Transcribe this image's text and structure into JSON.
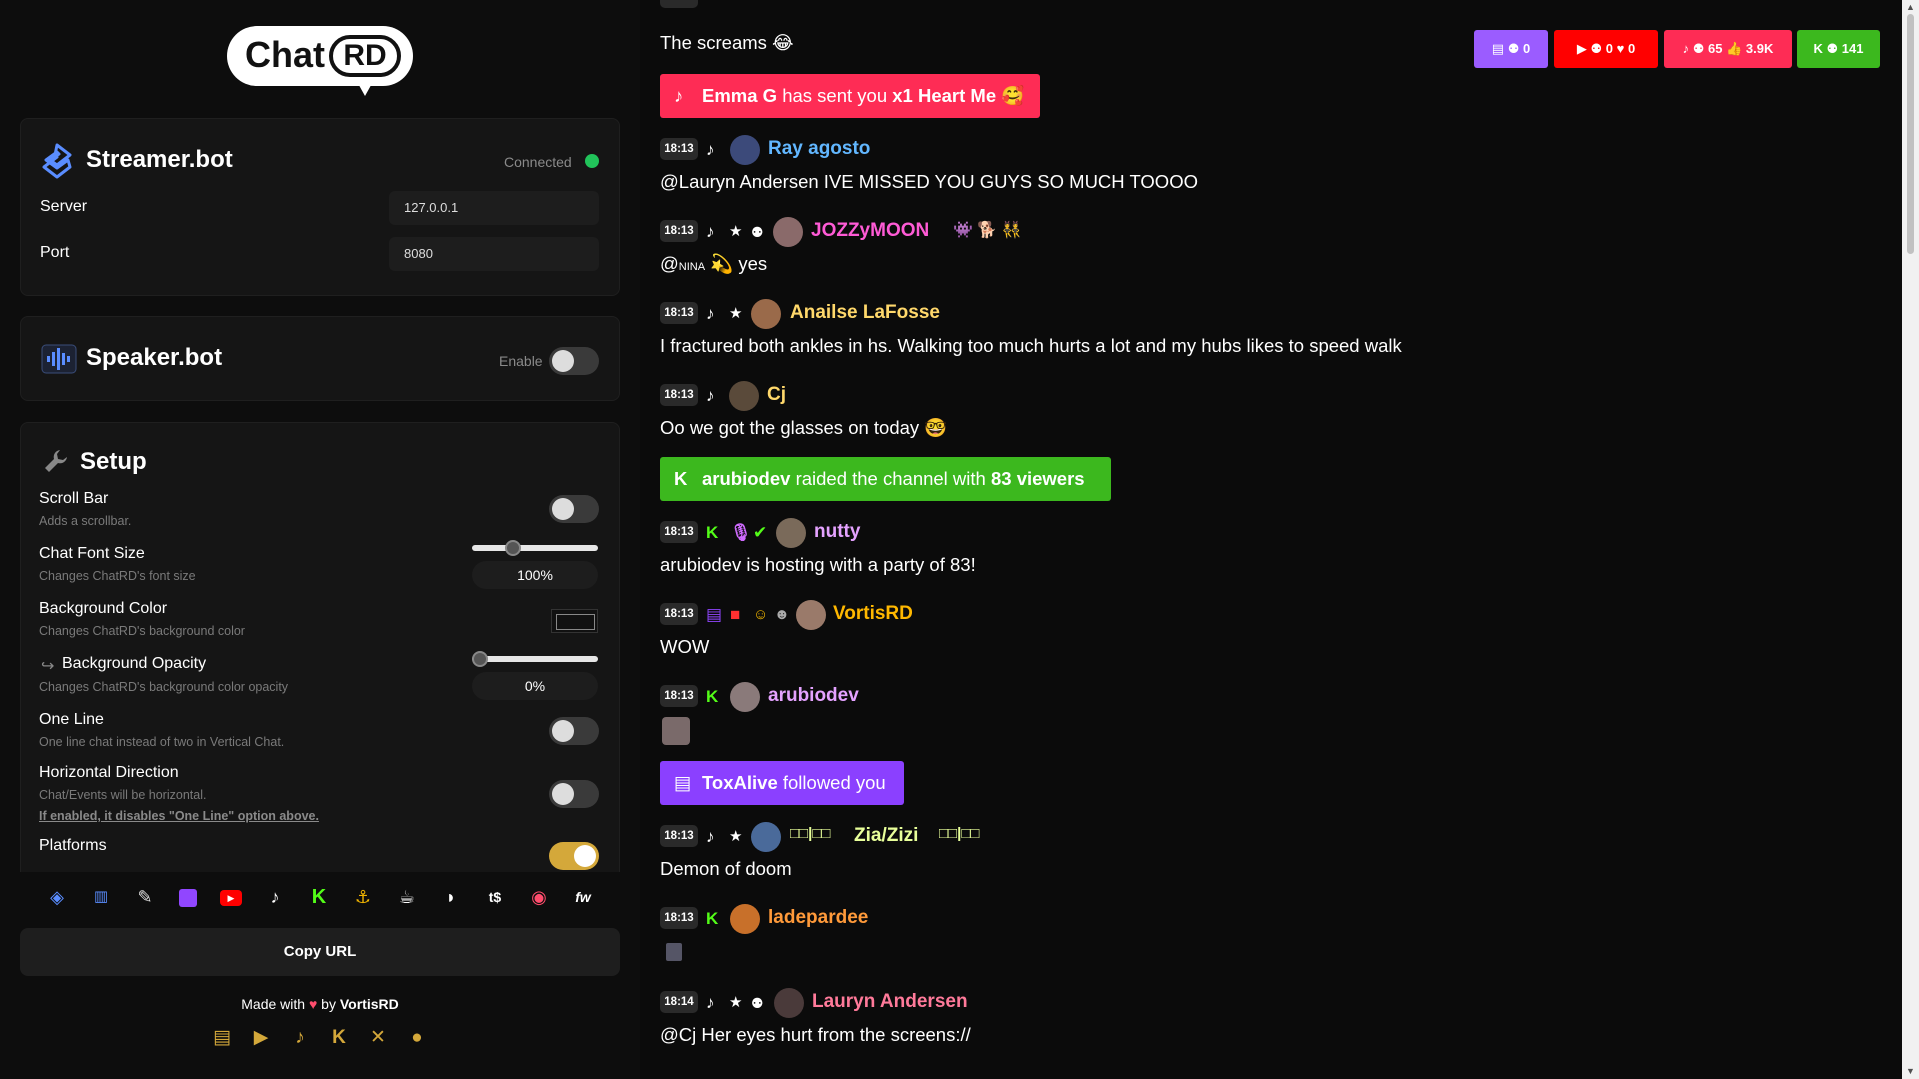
{
  "logo": {
    "chat": "Chat",
    "rd": "RD"
  },
  "streamerbot": {
    "title": "Streamer.bot",
    "status": "Connected",
    "server_label": "Server",
    "server_value": "127.0.0.1",
    "port_label": "Port",
    "port_value": "8080"
  },
  "speakerbot": {
    "title": "Speaker.bot",
    "enable_label": "Enable"
  },
  "setup": {
    "title": "Setup",
    "scroll_bar": {
      "label": "Scroll Bar",
      "desc": "Adds a scrollbar."
    },
    "font_size": {
      "label": "Chat Font Size",
      "desc": "Changes ChatRD's font size",
      "value": "100%",
      "slider": 0.3
    },
    "bg_color": {
      "label": "Background Color",
      "desc": "Changes ChatRD's background color"
    },
    "bg_opacity": {
      "label": "Background Opacity",
      "desc": "Changes ChatRD's background color opacity",
      "value": "0%",
      "slider": 0
    },
    "one_line": {
      "label": "One Line",
      "desc": "One line chat instead of two in Vertical Chat."
    },
    "horizontal": {
      "label": "Horizontal Direction",
      "desc": "Chat/Events will be horizontal.",
      "warn": "If enabled, it disables \"One Line\" option above."
    },
    "platforms": {
      "label": "Platforms"
    }
  },
  "copy_url": "Copy URL",
  "footer": {
    "made_with": "Made with",
    "by": "by",
    "author": "VortisRD"
  },
  "stats": {
    "twitch_viewers": "0",
    "yt_viewers": "0",
    "yt_likes": "0",
    "tiktok_viewers": "65",
    "tiktok_likes": "3.9K",
    "kick_viewers": "141"
  },
  "colors": {
    "twitch": "#9146ff",
    "youtube": "#ff0000",
    "tiktok": "#fe2c55",
    "kick": "#53fc18",
    "accent": "#d4a83a"
  },
  "chat": {
    "top_text": "The screams 😂",
    "event_heart": {
      "user": "Emma G",
      "mid": "has sent you",
      "gift": "x1 Heart Me",
      "emoji": "🥰"
    },
    "messages": [
      {
        "time": "18:13",
        "user": "Ray agosto",
        "text": "@Lauryn Andersen IVE MISSED YOU GUYS SO MUCH TOOOO"
      },
      {
        "time": "18:13",
        "user": "JOZZyMOON",
        "badges": "👾 🐕 👯",
        "text": "yes",
        "mention": "@"
      },
      {
        "time": "18:13",
        "user": "Anailse LaFosse",
        "text": "I fractured both ankles in hs. Walking too much hurts a lot and my hubs likes to speed walk"
      },
      {
        "time": "18:13",
        "user": "Cj",
        "text": "Oo we got the glasses on today 🤓"
      }
    ],
    "event_raid": {
      "user": "arubiodev",
      "mid": "raided the channel with",
      "count": "83 viewers"
    },
    "messages2": [
      {
        "time": "18:13",
        "user": "nutty",
        "text": "arubiodev is hosting with a party of 83!"
      },
      {
        "time": "18:13",
        "user": "VortisRD",
        "text": "WOW"
      },
      {
        "time": "18:13",
        "user": "arubiodev",
        "text": ""
      }
    ],
    "event_follow": {
      "user": "ToxAlive",
      "mid": "followed you"
    },
    "messages3": [
      {
        "time": "18:13",
        "user": "Zia/Zizi",
        "text": "Demon of doom"
      },
      {
        "time": "18:13",
        "user": "ladepardee",
        "text": ""
      },
      {
        "time": "18:14",
        "user": "Lauryn Andersen",
        "text": "@Cj Her eyes hurt from the screens://"
      }
    ]
  }
}
